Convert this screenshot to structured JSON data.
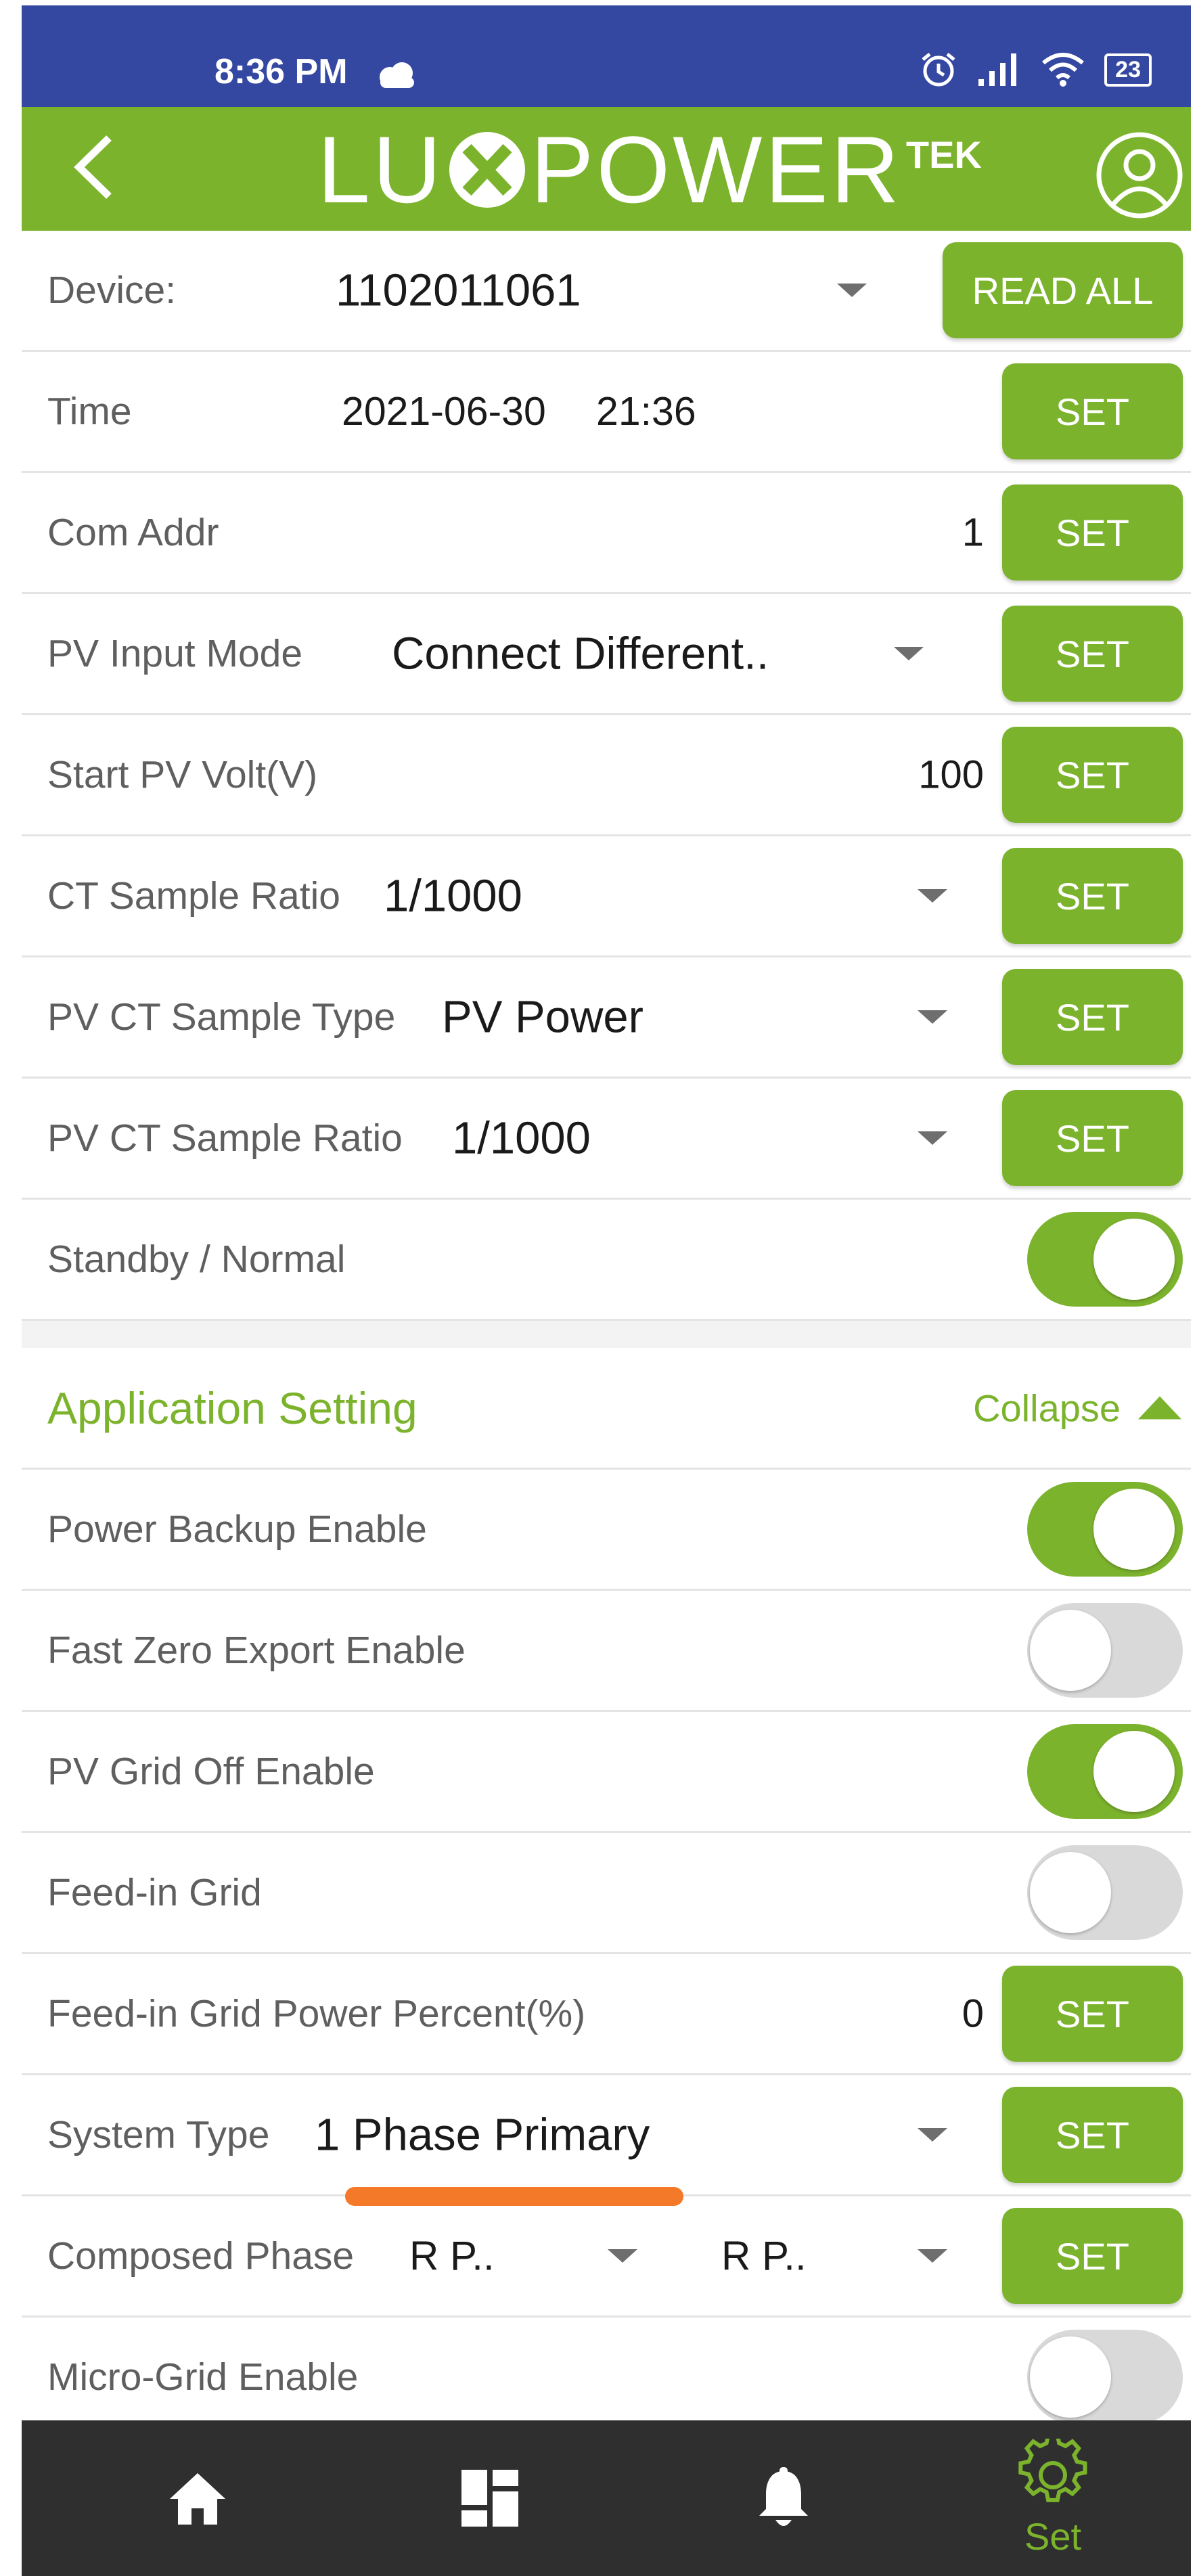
{
  "status_bar": {
    "time": "8:36 PM",
    "battery": "23"
  },
  "header": {
    "logo_text": [
      "LU",
      "POWER"
    ],
    "logo_suffix": "TEK"
  },
  "device": {
    "label": "Device:",
    "value": "1102011061",
    "button": "READ ALL"
  },
  "rows": {
    "time": {
      "label": "Time",
      "date": "2021-06-30",
      "clock": "21:36",
      "button": "SET"
    },
    "com_addr": {
      "label": "Com Addr",
      "value": "1",
      "button": "SET"
    },
    "pv_input_mode": {
      "label": "PV Input Mode",
      "value": "Connect Different..",
      "button": "SET"
    },
    "start_pv_volt": {
      "label": "Start PV Volt(V)",
      "value": "100",
      "button": "SET"
    },
    "ct_sample_ratio": {
      "label": "CT Sample Ratio",
      "value": "1/1000",
      "button": "SET"
    },
    "pv_ct_sample_type": {
      "label": "PV CT Sample Type",
      "value": "PV Power",
      "button": "SET"
    },
    "pv_ct_sample_ratio": {
      "label": "PV CT Sample Ratio",
      "value": "1/1000",
      "button": "SET"
    },
    "standby_normal": {
      "label": "Standby / Normal",
      "on": true
    }
  },
  "application_setting": {
    "title": "Application Setting",
    "collapse_label": "Collapse",
    "power_backup": {
      "label": "Power Backup Enable",
      "on": true
    },
    "fast_zero_export": {
      "label": "Fast Zero Export Enable",
      "on": false
    },
    "pv_grid_off": {
      "label": "PV Grid Off Enable",
      "on": true
    },
    "feed_in_grid": {
      "label": "Feed-in Grid",
      "on": false
    },
    "feed_in_grid_power_percent": {
      "label": "Feed-in Grid Power Percent(%)",
      "value": "0",
      "button": "SET"
    },
    "system_type": {
      "label": "System Type",
      "value": "1 Phase Primary",
      "button": "SET"
    },
    "composed_phase": {
      "label": "Composed Phase",
      "value_a": "R P..",
      "value_b": "R P..",
      "button": "SET"
    },
    "micro_grid": {
      "label": "Micro-Grid Enable",
      "on": false
    }
  },
  "bottom_nav": {
    "set_label": "Set"
  },
  "colors": {
    "status_bar": "#3447a1",
    "accent_green": "#7cb32d",
    "bottom_bar": "#2f2f2f",
    "highlight_orange": "#f47a2a"
  },
  "icons": [
    "cloud-icon",
    "alarm-icon",
    "signal-icon",
    "wifi-icon",
    "battery-icon",
    "back-icon",
    "logo-x-icon",
    "user-icon",
    "caret-down-icon",
    "caret-up-icon",
    "home-icon",
    "dashboard-icon",
    "bell-icon",
    "gear-icon"
  ]
}
